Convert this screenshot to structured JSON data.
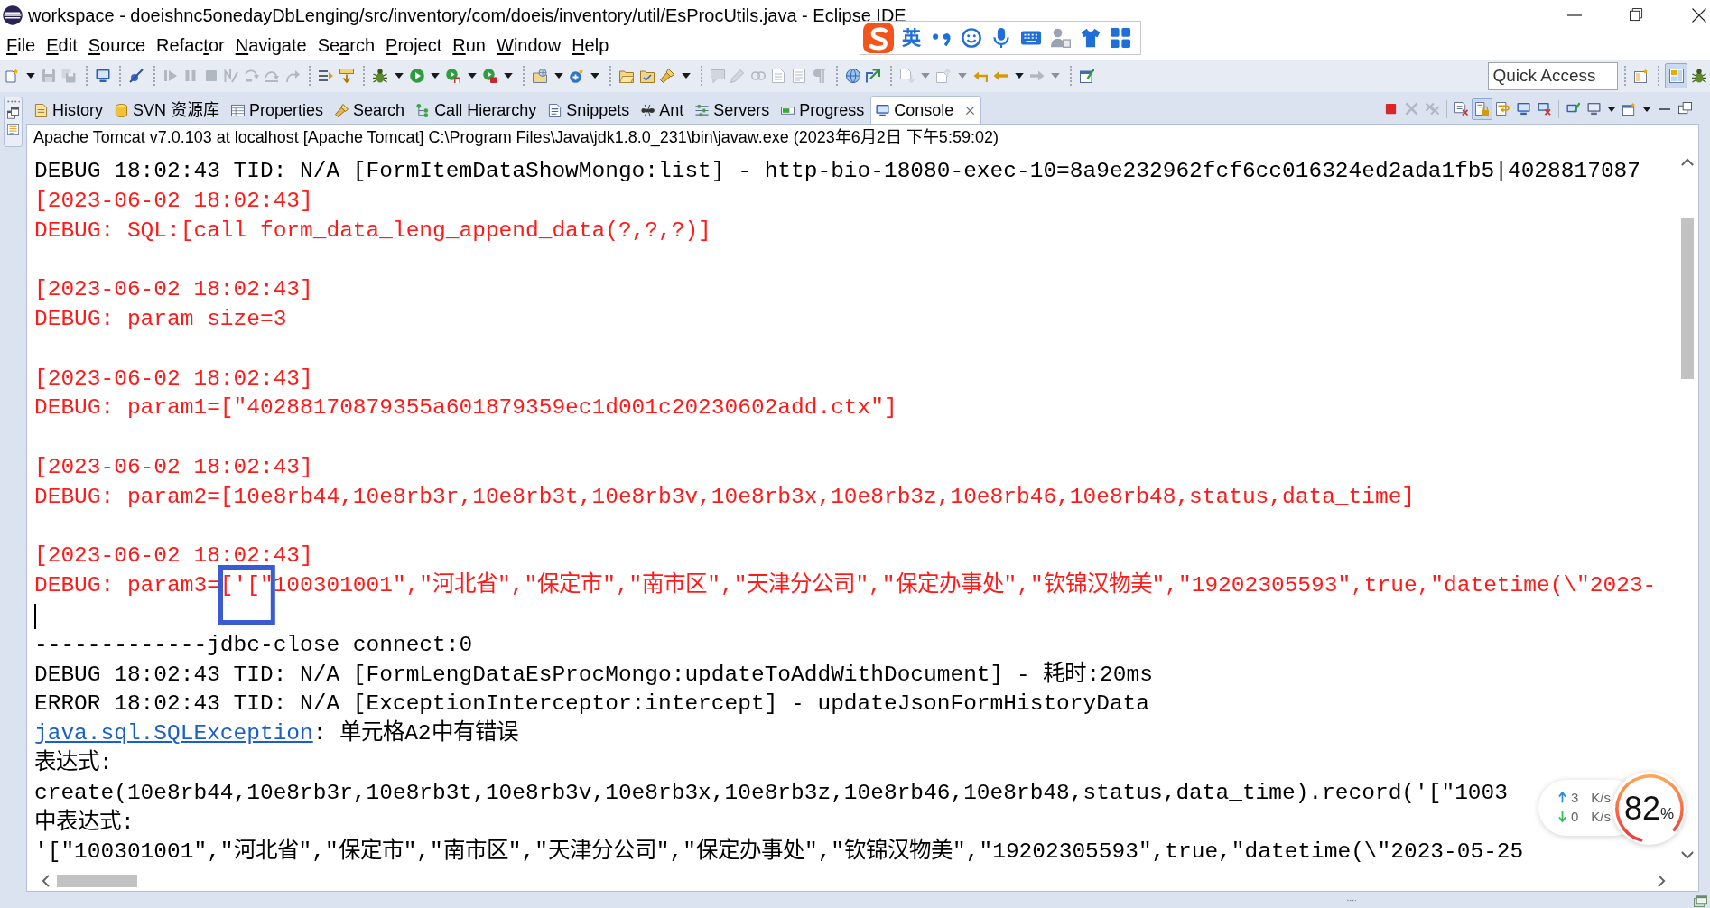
{
  "window": {
    "title": "workspace - doeishnc5onedayDbLenging/src/inventory/com/doeis/inventory/util/EsProcUtils.java - Eclipse IDE"
  },
  "ime_bar": {
    "mode": "英"
  },
  "menu": [
    {
      "accel": "F",
      "after": "ile"
    },
    {
      "accel": "E",
      "after": "dit"
    },
    {
      "accel": "S",
      "after": "ource"
    },
    {
      "before": "Refac",
      "accel": "t",
      "after": "or"
    },
    {
      "accel": "N",
      "after": "avigate"
    },
    {
      "before": "Se",
      "accel": "a",
      "after": "rch"
    },
    {
      "accel": "P",
      "after": "roject"
    },
    {
      "accel": "R",
      "after": "un"
    },
    {
      "accel": "W",
      "after": "indow"
    },
    {
      "accel": "H",
      "after": "elp"
    }
  ],
  "toolbar": [
    {
      "kind": "new",
      "disabled": false,
      "menu": true
    },
    {
      "kind": "save",
      "disabled": true,
      "menu": false
    },
    {
      "kind": "save_all",
      "disabled": true,
      "menu": false
    },
    {
      "kind": "separator"
    },
    {
      "kind": "terminal",
      "disabled": false,
      "menu": false
    },
    {
      "kind": "separator"
    },
    {
      "kind": "skip_breakpoints",
      "disabled": false,
      "menu": false
    },
    {
      "kind": "separator"
    },
    {
      "kind": "resume",
      "disabled": true,
      "menu": false
    },
    {
      "kind": "suspend",
      "disabled": true,
      "menu": false
    },
    {
      "kind": "terminate",
      "disabled": true,
      "menu": false
    },
    {
      "kind": "disconnect",
      "disabled": true,
      "menu": false
    },
    {
      "kind": "step_into",
      "disabled": true,
      "menu": false
    },
    {
      "kind": "step_over",
      "disabled": true,
      "menu": false
    },
    {
      "kind": "step_return",
      "disabled": true,
      "menu": false
    },
    {
      "kind": "separator"
    },
    {
      "kind": "step_filters",
      "disabled": false,
      "menu": false
    },
    {
      "kind": "drop_frame",
      "disabled": false,
      "menu": false
    },
    {
      "kind": "separator"
    },
    {
      "kind": "debug",
      "disabled": false,
      "menu": true
    },
    {
      "kind": "run",
      "disabled": false,
      "menu": true
    },
    {
      "kind": "coverage",
      "disabled": false,
      "menu": true
    },
    {
      "kind": "external",
      "disabled": false,
      "menu": true
    },
    {
      "kind": "separator"
    },
    {
      "kind": "new_project",
      "disabled": false,
      "menu": true
    },
    {
      "kind": "new_class",
      "disabled": false,
      "menu": true
    },
    {
      "kind": "separator"
    },
    {
      "kind": "open_type",
      "disabled": false,
      "menu": false
    },
    {
      "kind": "open_task",
      "disabled": false,
      "menu": false
    },
    {
      "kind": "search",
      "disabled": false,
      "menu": true
    },
    {
      "kind": "separator"
    },
    {
      "kind": "mark",
      "disabled": true,
      "menu": false
    },
    {
      "kind": "highlight",
      "disabled": true,
      "menu": false
    },
    {
      "kind": "link",
      "disabled": true,
      "menu": false
    },
    {
      "kind": "block",
      "disabled": true,
      "menu": false
    },
    {
      "kind": "doc",
      "disabled": true,
      "menu": false
    },
    {
      "kind": "pilcrow",
      "disabled": true,
      "menu": false
    },
    {
      "kind": "separator"
    },
    {
      "kind": "globe",
      "disabled": false,
      "menu": false
    },
    {
      "kind": "export",
      "disabled": false,
      "menu": false
    },
    {
      "kind": "separator"
    },
    {
      "kind": "next_annotation",
      "disabled": true,
      "menu": true
    },
    {
      "kind": "prev_annotation",
      "disabled": true,
      "menu": true
    },
    {
      "kind": "last_edit",
      "disabled": false,
      "menu": false
    },
    {
      "kind": "back",
      "disabled": false,
      "menu": true
    },
    {
      "kind": "forward",
      "disabled": true,
      "menu": true
    },
    {
      "kind": "separator"
    },
    {
      "kind": "new_window",
      "disabled": false,
      "menu": false
    }
  ],
  "quick_access": {
    "placeholder": "Quick Access"
  },
  "perspectives": [
    {
      "kind": "java_ee",
      "selected": true
    },
    {
      "kind": "debug",
      "selected": false
    }
  ],
  "tabs": [
    {
      "kind": "history",
      "label": "History",
      "selected": false
    },
    {
      "kind": "svn",
      "label": "SVN 资源库",
      "selected": false
    },
    {
      "kind": "properties",
      "label": "Properties",
      "selected": false
    },
    {
      "kind": "search",
      "label": "Search",
      "selected": false
    },
    {
      "kind": "hierarchy",
      "label": "Call Hierarchy",
      "selected": false
    },
    {
      "kind": "snippets",
      "label": "Snippets",
      "selected": false
    },
    {
      "kind": "ant",
      "label": "Ant",
      "selected": false
    },
    {
      "kind": "servers",
      "label": "Servers",
      "selected": false
    },
    {
      "kind": "progress",
      "label": "Progress",
      "selected": false
    },
    {
      "kind": "console",
      "label": "Console",
      "selected": true
    }
  ],
  "view_toolbar": [
    {
      "kind": "terminate",
      "disabled": false,
      "on": false,
      "menu": false
    },
    {
      "kind": "remove",
      "disabled": true,
      "on": false,
      "menu": false
    },
    {
      "kind": "remove_all",
      "disabled": true,
      "on": false,
      "menu": false
    },
    {
      "kind": "separator"
    },
    {
      "kind": "clear",
      "disabled": false,
      "on": false,
      "menu": false
    },
    {
      "kind": "scroll_lock",
      "disabled": false,
      "on": true,
      "menu": false
    },
    {
      "kind": "word_wrap",
      "disabled": false,
      "on": false,
      "menu": false
    },
    {
      "kind": "show_out",
      "disabled": false,
      "on": false,
      "menu": false
    },
    {
      "kind": "show_err",
      "disabled": false,
      "on": false,
      "menu": false
    },
    {
      "kind": "separator"
    },
    {
      "kind": "pin",
      "disabled": false,
      "on": false,
      "menu": false
    },
    {
      "kind": "display",
      "disabled": false,
      "on": false,
      "menu": true
    },
    {
      "kind": "open_console",
      "disabled": false,
      "on": false,
      "menu": true
    },
    {
      "kind": "minimize",
      "disabled": false,
      "on": false,
      "menu": false
    },
    {
      "kind": "maximize",
      "disabled": false,
      "on": false,
      "menu": false
    }
  ],
  "console": {
    "header": "Apache Tomcat v7.0.103 at localhost [Apache Tomcat] C:\\Program Files\\Java\\jdk1.8.0_231\\bin\\javaw.exe (2023年6月2日 下午5:59:02)",
    "lines": [
      {
        "kind": "text",
        "error": false,
        "text": "DEBUG 18:02:43 TID: N/A [FormItemDataShowMongo:list] - http-bio-18080-exec-10=8a9e232962fcf6cc016324ed2ada1fb5|4028817087"
      },
      {
        "kind": "text",
        "error": true,
        "text": "[2023-06-02 18:02:43]"
      },
      {
        "kind": "text",
        "error": true,
        "text": "DEBUG: SQL:[call form_data_leng_append_data(?,?,?)]"
      },
      {
        "kind": "blank"
      },
      {
        "kind": "text",
        "error": true,
        "text": "[2023-06-02 18:02:43]"
      },
      {
        "kind": "text",
        "error": true,
        "text": "DEBUG: param size=3"
      },
      {
        "kind": "blank"
      },
      {
        "kind": "text",
        "error": true,
        "text": "[2023-06-02 18:02:43]"
      },
      {
        "kind": "text",
        "error": true,
        "text": "DEBUG: param1=[\"40288170879355a601879359ec1d001c20230602add.ctx\"]"
      },
      {
        "kind": "blank"
      },
      {
        "kind": "text",
        "error": true,
        "text": "[2023-06-02 18:02:43]"
      },
      {
        "kind": "text",
        "error": true,
        "text": "DEBUG: param2=[10e8rb44,10e8rb3r,10e8rb3t,10e8rb3v,10e8rb3x,10e8rb3z,10e8rb46,10e8rb48,status,data_time]"
      },
      {
        "kind": "blank"
      },
      {
        "kind": "text",
        "error": true,
        "text": "[2023-06-02 18:02:43]"
      },
      {
        "kind": "framed",
        "error": true,
        "text": "DEBUG: param3=['[\"100301001\",\"河北省\",\"保定市\",\"南市区\",\"天津分公司\",\"保定办事处\",\"钦锦汉物美\",\"19202305593\",true,\"datetime(\\\"2023-"
      },
      {
        "kind": "cursor"
      },
      {
        "kind": "text",
        "error": false,
        "text": "-------------jdbc-close connect:0"
      },
      {
        "kind": "text",
        "error": false,
        "text": "DEBUG 18:02:43 TID: N/A [FormLengDataEsProcMongo:updateToAddWithDocument] - 耗时:20ms"
      },
      {
        "kind": "text",
        "error": false,
        "text": "ERROR 18:02:43 TID: N/A [ExceptionInterceptor:intercept] - updateJsonFormHistoryData"
      },
      {
        "kind": "link",
        "error": false,
        "link": "java.sql.SQLException",
        "text": ": 单元格A2中有错误"
      },
      {
        "kind": "text",
        "error": false,
        "text": "表达式:"
      },
      {
        "kind": "text",
        "error": false,
        "text": "create(10e8rb44,10e8rb3r,10e8rb3t,10e8rb3v,10e8rb3x,10e8rb3z,10e8rb46,10e8rb48,status,data_time).record('[\"1003"
      },
      {
        "kind": "text",
        "error": false,
        "text": "中表达式:"
      },
      {
        "kind": "text",
        "error": false,
        "text": "'[\"100301001\",\"河北省\",\"保定市\",\"南市区\",\"天津分公司\",\"保定办事处\",\"钦锦汉物美\",\"19202305593\",true,\"datetime(\\\"2023-05-25"
      }
    ]
  },
  "net_monitor": {
    "upload": {
      "value": "3",
      "unit": "K/s"
    },
    "download": {
      "value": "0",
      "unit": "K/s"
    },
    "memory": {
      "value": "82",
      "unit": "%"
    }
  }
}
